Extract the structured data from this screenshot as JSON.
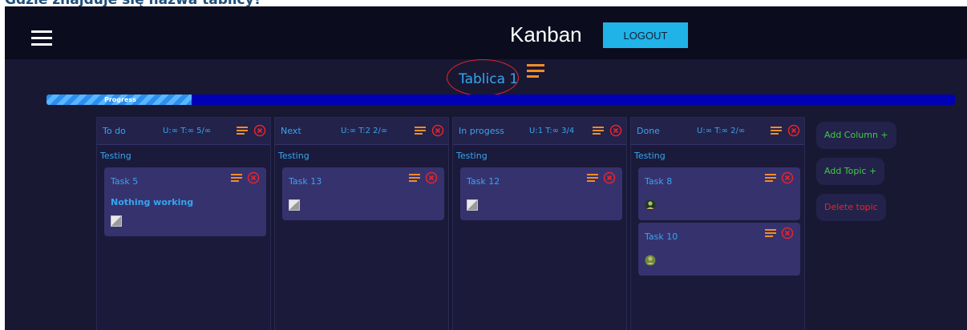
{
  "caption": "Gdzie znajduje się nazwa tablicy?",
  "navbar": {
    "brand": "Kanban",
    "logout_label": "LOGOUT"
  },
  "board": {
    "title": "Tablica 1",
    "progress_label": "Progress",
    "progress_fraction": 0.16
  },
  "columns": [
    {
      "name": "To do",
      "stats": "U:∞ T:∞ 5/∞",
      "topic": "Testing",
      "cards": [
        {
          "title": "Task 5",
          "description": "Nothing working",
          "attachment": "broken-image-icon"
        }
      ]
    },
    {
      "name": "Next",
      "stats": "U:∞ T:2 2/∞",
      "topic": "Testing",
      "cards": [
        {
          "title": "Task 13",
          "attachment": "broken-image-icon"
        }
      ]
    },
    {
      "name": "In progess",
      "stats": "U:1 T:∞ 3/4",
      "topic": "Testing",
      "cards": [
        {
          "title": "Task 12",
          "attachment": "broken-image-icon"
        }
      ]
    },
    {
      "name": "Done",
      "stats": "U:∞ T:∞ 2/∞",
      "topic": "Testing",
      "cards": [
        {
          "title": "Task 8",
          "attachment": "user-avatar"
        },
        {
          "title": "Task 10",
          "attachment": "user-avatar"
        }
      ]
    }
  ],
  "actions": {
    "add_column": "Add Column +",
    "add_topic": "Add Topic +",
    "delete_topic": "Delete topic"
  },
  "colors": {
    "accent": "#35a6f0",
    "menu_icon": "#f28c28",
    "close_icon": "#e8252a",
    "add_button_text": "#3ecf3e",
    "delete_button_text": "#e8252a",
    "logout_button": "#1fb3e8"
  }
}
